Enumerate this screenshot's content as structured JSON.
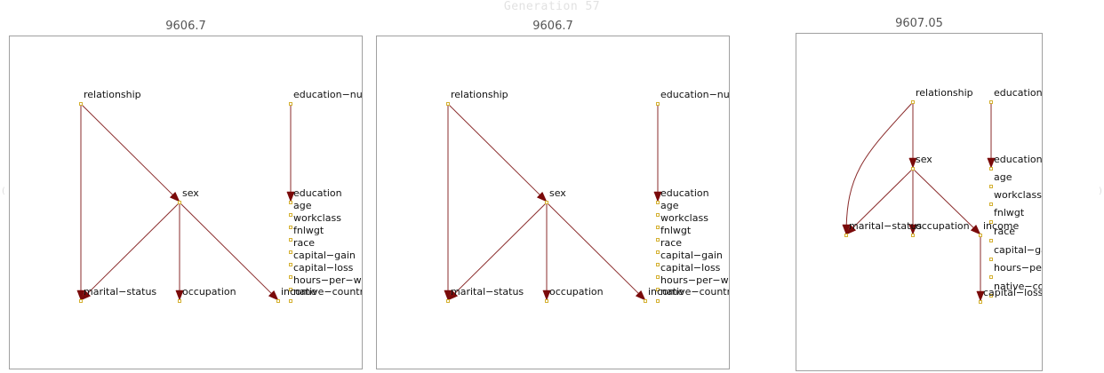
{
  "generation_title": "Generation 57",
  "panels": [
    {
      "score": "9606.7",
      "nodes": [
        {
          "id": "relationship",
          "label": "relationship"
        },
        {
          "id": "education-num",
          "label": "education−num"
        },
        {
          "id": "sex",
          "label": "sex"
        },
        {
          "id": "education",
          "label": "education"
        },
        {
          "id": "age",
          "label": "age"
        },
        {
          "id": "workclass",
          "label": "workclass"
        },
        {
          "id": "fnlwgt",
          "label": "fnlwgt"
        },
        {
          "id": "race",
          "label": "race"
        },
        {
          "id": "capital-gain",
          "label": "capital−gain"
        },
        {
          "id": "capital-loss",
          "label": "capital−loss"
        },
        {
          "id": "hours-per-week",
          "label": "hours−per−week"
        },
        {
          "id": "native-country",
          "label": "native−country"
        },
        {
          "id": "marital-status",
          "label": "marital−status"
        },
        {
          "id": "occupation",
          "label": "occupation"
        },
        {
          "id": "income",
          "label": "income"
        }
      ],
      "edges": [
        {
          "from": "relationship",
          "to": "sex"
        },
        {
          "from": "relationship",
          "to": "marital-status"
        },
        {
          "from": "education-num",
          "to": "education"
        },
        {
          "from": "sex",
          "to": "marital-status"
        },
        {
          "from": "sex",
          "to": "occupation"
        },
        {
          "from": "sex",
          "to": "income"
        }
      ]
    },
    {
      "score": "9606.7",
      "nodes": [
        {
          "id": "relationship",
          "label": "relationship"
        },
        {
          "id": "education-num",
          "label": "education−num"
        },
        {
          "id": "sex",
          "label": "sex"
        },
        {
          "id": "education",
          "label": "education"
        },
        {
          "id": "age",
          "label": "age"
        },
        {
          "id": "workclass",
          "label": "workclass"
        },
        {
          "id": "fnlwgt",
          "label": "fnlwgt"
        },
        {
          "id": "race",
          "label": "race"
        },
        {
          "id": "capital-gain",
          "label": "capital−gain"
        },
        {
          "id": "capital-loss",
          "label": "capital−loss"
        },
        {
          "id": "hours-per-week",
          "label": "hours−per−week"
        },
        {
          "id": "native-country",
          "label": "native−country"
        },
        {
          "id": "marital-status",
          "label": "marital−status"
        },
        {
          "id": "occupation",
          "label": "occupation"
        },
        {
          "id": "income",
          "label": "income"
        }
      ],
      "edges": [
        {
          "from": "relationship",
          "to": "sex"
        },
        {
          "from": "relationship",
          "to": "marital-status"
        },
        {
          "from": "education-num",
          "to": "education"
        },
        {
          "from": "sex",
          "to": "marital-status"
        },
        {
          "from": "sex",
          "to": "occupation"
        },
        {
          "from": "sex",
          "to": "income"
        }
      ]
    },
    {
      "score": "9607.05",
      "nodes": [
        {
          "id": "relationship",
          "label": "relationship"
        },
        {
          "id": "education-num",
          "label": "education−num"
        },
        {
          "id": "sex",
          "label": "sex"
        },
        {
          "id": "education",
          "label": "education"
        },
        {
          "id": "age",
          "label": "age"
        },
        {
          "id": "workclass",
          "label": "workclass"
        },
        {
          "id": "fnlwgt",
          "label": "fnlwgt"
        },
        {
          "id": "marital-status",
          "label": "marital−status"
        },
        {
          "id": "occupation",
          "label": "occupation"
        },
        {
          "id": "income",
          "label": "income"
        },
        {
          "id": "race",
          "label": "race"
        },
        {
          "id": "capital-gain",
          "label": "capital−gain"
        },
        {
          "id": "hours-per-week",
          "label": "hours−per−week"
        },
        {
          "id": "native-country",
          "label": "native−country"
        },
        {
          "id": "capital-loss",
          "label": "capital−loss"
        }
      ],
      "edges": [
        {
          "from": "relationship",
          "to": "marital-status",
          "curved": true
        },
        {
          "from": "relationship",
          "to": "sex"
        },
        {
          "from": "education-num",
          "to": "education"
        },
        {
          "from": "sex",
          "to": "marital-status"
        },
        {
          "from": "sex",
          "to": "occupation"
        },
        {
          "from": "sex",
          "to": "income"
        },
        {
          "from": "income",
          "to": "capital-loss"
        }
      ]
    }
  ]
}
